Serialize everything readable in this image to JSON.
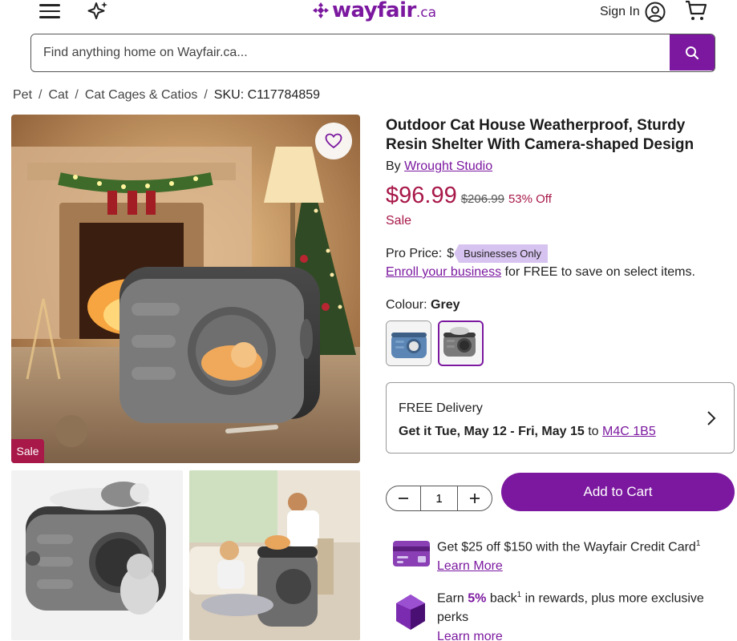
{
  "header": {
    "logo_text": "wayfair",
    "logo_tld": ".ca",
    "signin_label": "Sign In",
    "menu_icon": "hamburger-menu-icon",
    "sparkle_icon": "sparkle-icon",
    "account_icon": "account-icon",
    "cart_icon": "cart-icon"
  },
  "search": {
    "placeholder": "Find anything home on Wayfair.ca...",
    "value": "",
    "icon": "search-icon"
  },
  "breadcrumb": {
    "items": [
      "Pet",
      "Cat",
      "Cat Cages & Catios"
    ],
    "separator": "/",
    "sku": "SKU: C117784859"
  },
  "gallery": {
    "sale_badge": "Sale",
    "favorite_icon": "heart-icon"
  },
  "product": {
    "title": "Outdoor Cat House Weatherproof, Sturdy Resin Shelter With Camera-shaped Design",
    "by_label": "By",
    "brand": "Wrought Studio",
    "price": "$96.99",
    "was_price": "$206.99",
    "discount": "53% Off",
    "sale_label": "Sale",
    "pro_price_label": "Pro Price:",
    "pro_price_masked": "$",
    "pro_badge": "Businesses Only",
    "enroll_link": "Enroll your business",
    "enroll_text": " for FREE to save on select items.",
    "colour_label": "Colour:",
    "colour_value": "Grey",
    "swatches": [
      "Blue",
      "Grey"
    ],
    "selected_swatch": "Grey"
  },
  "delivery": {
    "title": "FREE Delivery",
    "get_it": "Get it Tue, May 12 - Fri, May 15",
    "to_label": " to ",
    "postal_code": "M4C 1B5"
  },
  "purchase": {
    "quantity": "1",
    "add_to_cart": "Add to Cart"
  },
  "promos": {
    "credit_text": "Get $25 off $150 with the Wayfair Credit Card",
    "credit_sup": "1",
    "credit_link": "Learn More",
    "rewards_pre": "Earn ",
    "rewards_pct": "5%",
    "rewards_mid": " back",
    "rewards_sup": "1",
    "rewards_post": " in rewards, plus more exclusive perks",
    "rewards_link": "Learn more"
  },
  "colors": {
    "brand_purple": "#7b189f",
    "sale_red": "#a81849",
    "pro_badge_bg": "#d7c3f0"
  }
}
